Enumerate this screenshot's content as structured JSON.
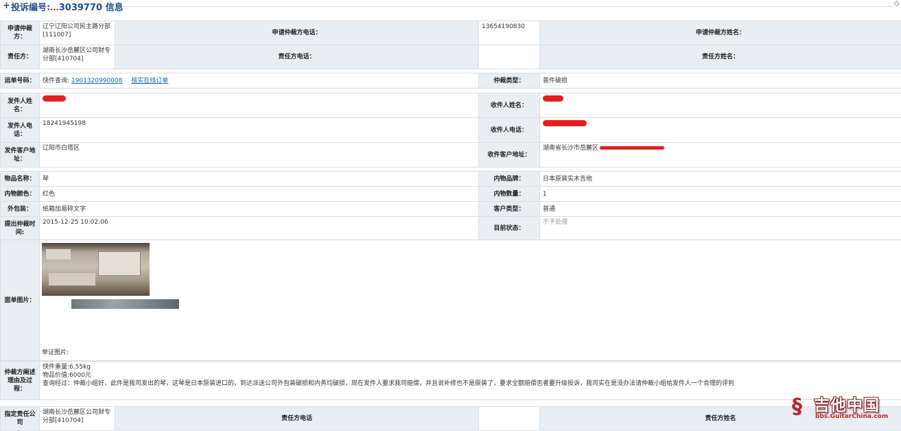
{
  "header": {
    "title_prefix": "投诉编号:",
    "title_mark": "...",
    "title_number": "3039770",
    "title_suffix": " 信息"
  },
  "arbitration": {
    "applicant_label": "申请仲裁方：",
    "applicant_value": "辽宁辽阳公司民主路分部[111007]",
    "applicant_phone_label": "申请仲裁方电话：",
    "applicant_phone_value": "13654190830",
    "applicant_name_label": "申请仲裁方姓名：",
    "responsible_label": "责任方：",
    "responsible_value": "湖南长沙岳麓区公司财专分部[410704]",
    "responsible_phone_label": "责任方电话：",
    "responsible_name_label": "责任方姓名："
  },
  "waybill": {
    "label": "运单号码：",
    "query_prefix": "快件查询:",
    "tracking_number": "1901320990008",
    "online_order_link": "核实在线订单",
    "type_label": "仲裁类型：",
    "type_value": "普件破损"
  },
  "people": {
    "sender_name_label": "发件人姓名：",
    "receiver_name_label": "收件人姓名：",
    "sender_phone_label": "发件人电话：",
    "sender_phone_value": "18241945198",
    "receiver_phone_label": "收件人电话：",
    "sender_address_label": "发件客户地址：",
    "sender_address_value": "辽阳市白塔区",
    "receiver_address_label": "收件客户地址：",
    "receiver_address_value": "湖南省长沙市岳麓区"
  },
  "goods": {
    "name_label": "物品名称：",
    "name_value": "琴",
    "brand_label": "内物品牌：",
    "brand_value": "日本原装实木吉他",
    "color_label": "内物颜色：",
    "color_value": "红色",
    "quantity_label": "内物数量：",
    "quantity_value": "1",
    "packaging_label": "外包装：",
    "packaging_value": "纸箱加易碎文字",
    "customer_type_label": "客户类型：",
    "customer_type_value": "普通",
    "submit_time_label": "提出仲裁时间:",
    "submit_time_value": "2015-12-25 10:02:06",
    "status_label": "目前状态：",
    "status_value": "不予处理"
  },
  "images": {
    "label": "面单图片：",
    "evidence_label": "举证图片:"
  },
  "statement": {
    "label": "仲裁方阐述理由及过程：",
    "weight": "快件重量:6.55kg",
    "value": "物品价值:6000元",
    "process": "查询经过：仲裁小组好，此件是我司发出的琴，这琴是日本原装进口的，到达派送公司外包装破损和内务均破损，现在发件人要求我司赔偿，并且说补修也不是原装了，要求全额赔偿否者要升级投诉，我司实在是没办法请仲裁小组给发件人一个合理的评判"
  },
  "assigned": {
    "label": "指定责任公司",
    "value": "湖南长沙岳麓区公司财专分部[410704]",
    "phone_label": "责任方电话",
    "name_label": "责任方姓名"
  },
  "watermark": {
    "name": "吉他中国",
    "url": "bbs.GuitarChina.com"
  },
  "colors": {
    "label_bg": "#e9eef2",
    "border": "#d6dde4",
    "link": "#1a5fb4",
    "title": "#1a4f8a",
    "redaction": "#e41f1f",
    "logo": "#c01f24"
  }
}
